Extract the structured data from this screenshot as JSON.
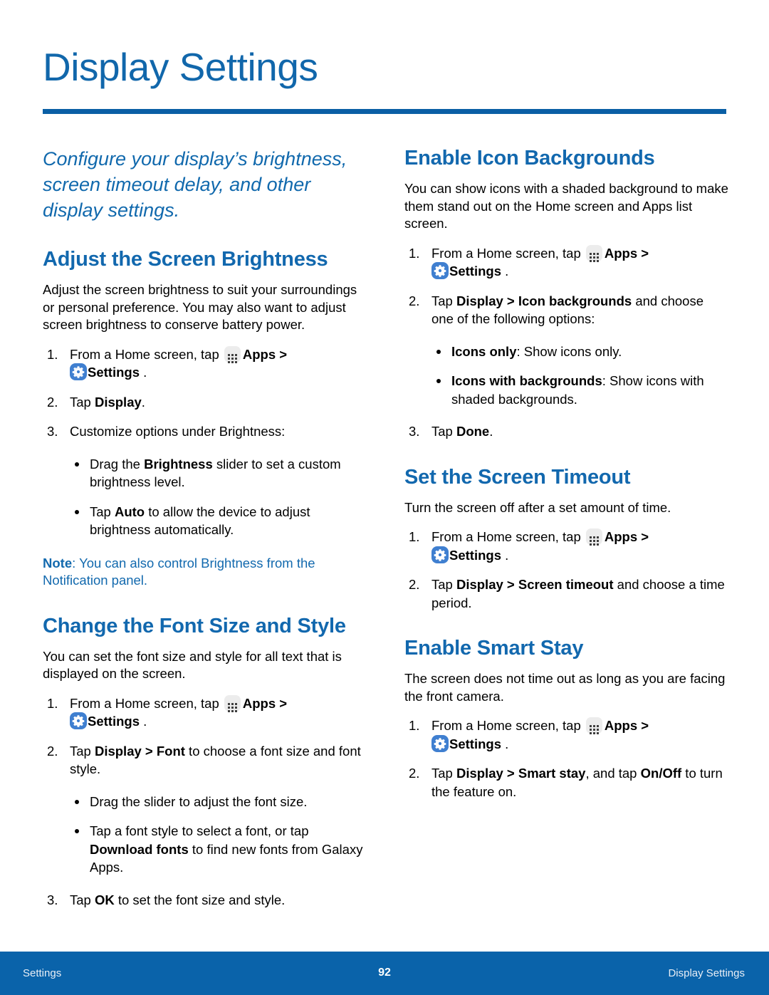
{
  "colors": {
    "title_blue": "#1167ab",
    "rule_blue": "#0a5fa5",
    "heading_blue": "#1268ae",
    "note_blue": "#1269ae",
    "footer_blue": "#0a63aa",
    "settings_icon_blue": "#3f7fd0",
    "apps_icon_gray": "#ececec"
  },
  "page": {
    "title": "Display Settings",
    "intro": "Configure your display’s brightness, screen timeout delay, and other display settings."
  },
  "icons": {
    "apps": "apps-grid-icon",
    "settings": "settings-gear-icon"
  },
  "labels": {
    "apps": "Apps",
    "settings": "Settings",
    "from_home_screen": "From a Home screen, tap",
    "chevron": ">",
    "period": "."
  },
  "left_column": {
    "sections": [
      {
        "heading": "Adjust the Screen Brightness",
        "body": "Adjust the screen brightness to suit your surroundings or personal preference. You may also want to adjust screen brightness to conserve battery power.",
        "steps": [
          {
            "num": "1.",
            "type": "home_settings"
          },
          {
            "num": "2.",
            "pre": "Tap ",
            "bold": "Display",
            "post": "."
          },
          {
            "num": "3.",
            "pre": "Customize options under Brightness:",
            "bold": "",
            "post": ""
          }
        ],
        "bullets": [
          {
            "pre": "Drag the ",
            "bold": "Brightness",
            "post": " slider to set a custom brightness level."
          },
          {
            "pre": "Tap ",
            "bold": "Auto",
            "post": " to allow the device to adjust brightness automatically."
          }
        ],
        "note": {
          "label": "Note",
          "text": ": You can also control Brightness from the Notification panel."
        }
      },
      {
        "heading": "Change the Font Size and Style",
        "body": "You can set the font size and style for all text that is displayed on the screen.",
        "steps": [
          {
            "num": "1.",
            "type": "home_settings"
          },
          {
            "num": "2.",
            "pre": "Tap ",
            "bold": "Display > Font",
            "post": " to choose a font size and font style."
          }
        ],
        "bullets": [
          {
            "pre": "Drag the slider to adjust the font size.",
            "bold": "",
            "post": ""
          },
          {
            "pre": "Tap a font style to select a font, or tap ",
            "bold": "Download fonts",
            "post": " to find new fonts from Galaxy Apps."
          }
        ],
        "last_step": {
          "num": "3.",
          "pre": "Tap ",
          "bold": "OK",
          "post": " to set the font size and style."
        }
      }
    ]
  },
  "right_column": {
    "sections": [
      {
        "heading": "Enable Icon Backgrounds",
        "body": "You can show icons with a shaded background to make them stand out on the Home screen and Apps list screen.",
        "steps": [
          {
            "num": "1.",
            "type": "home_settings"
          },
          {
            "num": "2.",
            "pre": "Tap ",
            "bold": "Display > Icon backgrounds",
            "post": " and choose one of the following options:"
          }
        ],
        "bullets": [
          {
            "pre": "",
            "bold": "Icons only",
            "post": ": Show icons only."
          },
          {
            "pre": "",
            "bold": "Icons with backgrounds",
            "post": ": Show icons with shaded backgrounds."
          }
        ],
        "last_step": {
          "num": "3.",
          "pre": "Tap ",
          "bold": "Done",
          "post": "."
        }
      },
      {
        "heading": "Set the Screen Timeout",
        "body": "Turn the screen off after a set amount of time.",
        "steps": [
          {
            "num": "1.",
            "type": "home_settings"
          },
          {
            "num": "2.",
            "pre": "Tap ",
            "bold": "Display > Screen timeout",
            "post": " and choose a time period."
          }
        ]
      },
      {
        "heading": "Enable Smart Stay",
        "body": "The screen does not time out as long as you are facing the front camera.",
        "steps": [
          {
            "num": "1.",
            "type": "home_settings"
          },
          {
            "num": "2.",
            "pre": "Tap ",
            "bold": "Display > Smart stay",
            "post": ", and tap ",
            "bold2": "On/Off",
            "post2": " to turn the feature on."
          }
        ]
      }
    ]
  },
  "footer": {
    "left": "Settings",
    "page_number": "92",
    "right": "Display Settings"
  }
}
